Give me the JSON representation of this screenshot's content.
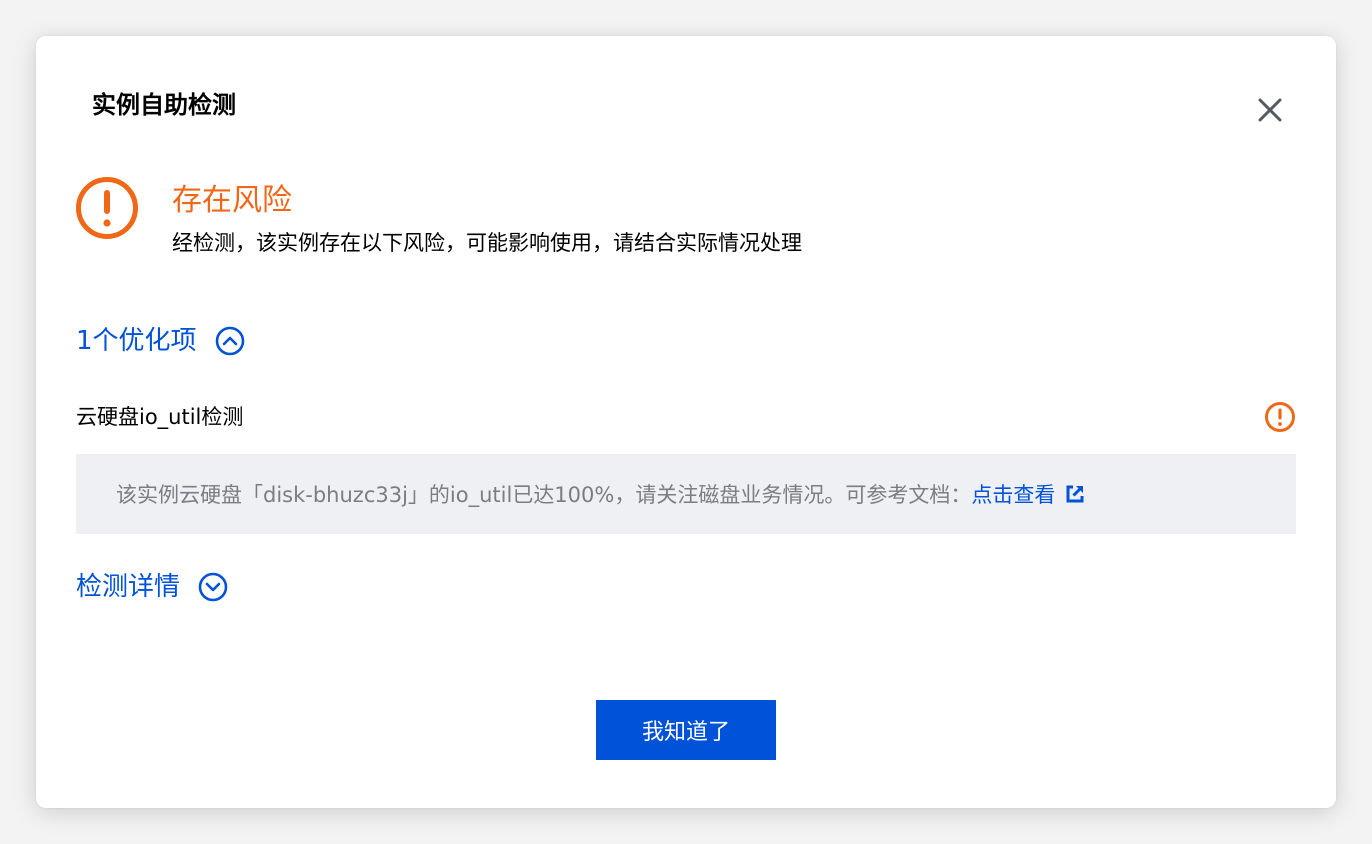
{
  "dialog": {
    "title": "实例自助检测"
  },
  "status": {
    "title": "存在风险",
    "description": "经检测，该实例存在以下风险，可能影响使用，请结合实际情况处理",
    "color": "#f06817"
  },
  "optimization": {
    "toggle_label": "1个优化项",
    "expanded": true,
    "items": [
      {
        "name": "云硬盘io_util检测",
        "level": "warning",
        "message": "该实例云硬盘「disk-bhuzc33j」的io_util已达100%，请关注磁盘业务情况。可参考文档：",
        "link_label": "点击查看"
      }
    ]
  },
  "details": {
    "toggle_label": "检测详情",
    "expanded": false
  },
  "footer": {
    "ok_label": "我知道了"
  },
  "colors": {
    "accent": "#0052d9",
    "warning": "#f06817",
    "item_bg": "#eff0f4"
  }
}
